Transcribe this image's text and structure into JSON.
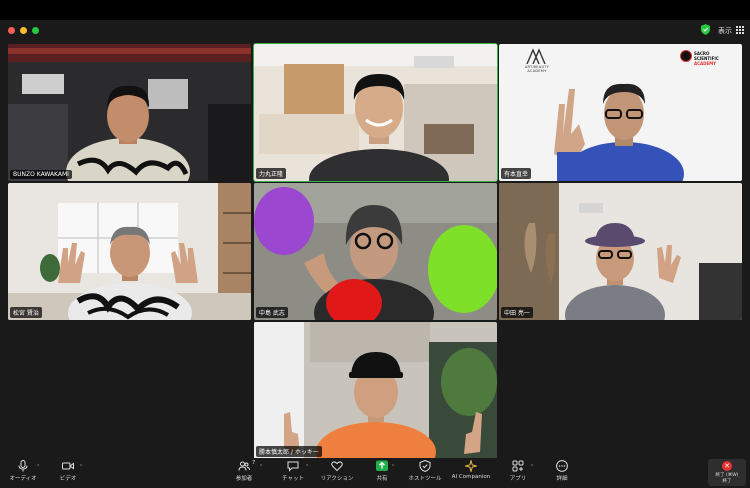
{
  "window": {
    "view_label": "表示",
    "icons": [
      "shield-check-icon",
      "grid-view-icon"
    ]
  },
  "participants": [
    {
      "name": "BUNZO KAWAKAMI",
      "active": false
    },
    {
      "name": "力丸正隆",
      "active": true
    },
    {
      "name": "有本直幸",
      "active": false
    },
    {
      "name": "松宮 賢治",
      "active": false
    },
    {
      "name": "中島 武志",
      "active": false
    },
    {
      "name": "中田 亮一",
      "active": false
    },
    {
      "name": "勝本慎太郎 / ホッキー",
      "active": false
    }
  ],
  "branding": {
    "left_logo_text": "ART-BEAUTY ACADEMY",
    "right_logo_line1": "SACRO",
    "right_logo_line2": "SCIENTIFIC",
    "right_logo_line3": "ACADEMY"
  },
  "toolbar": {
    "items": [
      {
        "label": "オーディオ",
        "icon": "microphone-icon"
      },
      {
        "label": "ビデオ",
        "icon": "video-camera-icon"
      },
      {
        "label": "参加者",
        "icon": "participants-icon",
        "count": "7"
      },
      {
        "label": "チャット",
        "icon": "chat-icon"
      },
      {
        "label": "リアクション",
        "icon": "heart-reaction-icon"
      },
      {
        "label": "共有",
        "icon": "share-screen-icon"
      },
      {
        "label": "ホストツール",
        "icon": "shield-icon"
      },
      {
        "label": "AI Companion",
        "icon": "sparkle-icon"
      },
      {
        "label": "アプリ",
        "icon": "apps-icon"
      },
      {
        "label": "詳細",
        "icon": "more-icon"
      }
    ],
    "end_label": "終了 (⌘W)",
    "end_sub": "終了"
  },
  "colors": {
    "active_speaker_border": "#35b04a",
    "share_green": "#21b04a",
    "end_red": "#e5322e"
  }
}
